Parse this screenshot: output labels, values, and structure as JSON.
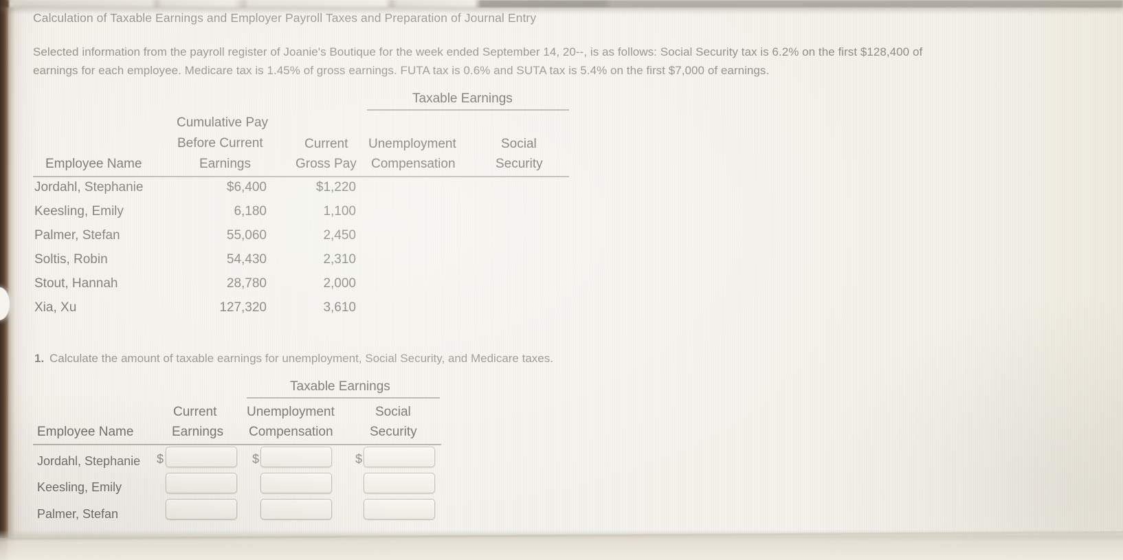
{
  "document": {
    "title": "Calculation of Taxable Earnings and Employer Payroll Taxes and Preparation of Journal Entry",
    "intro_line_1": "Selected information from the payroll register of Joanie's Boutique for the week ended September 14, 20--, is as follows: Social Security tax is 6.2% on the first $128,400 of",
    "intro_line_2": "earnings for each employee. Medicare tax is 1.45% of gross earnings. FUTA tax is 0.6% and SUTA tax is 5.4% on the first $7,000 of earnings."
  },
  "reference_table": {
    "group_header": "Taxable Earnings",
    "headers": {
      "employee_name": "Employee Name",
      "cumulative_line1": "Cumulative Pay",
      "cumulative_line2": "Before Current",
      "cumulative_line3": "Earnings",
      "current_line1": "Current",
      "current_line2": "Gross Pay",
      "unemployment_line1": "Unemployment",
      "unemployment_line2": "Compensation",
      "social_line1": "Social",
      "social_line2": "Security"
    },
    "rows": [
      {
        "name": "Jordahl, Stephanie",
        "cumulative": "$6,400",
        "gross": "$1,220"
      },
      {
        "name": "Keesling, Emily",
        "cumulative": "6,180",
        "gross": "1,100"
      },
      {
        "name": "Palmer, Stefan",
        "cumulative": "55,060",
        "gross": "2,450"
      },
      {
        "name": "Soltis, Robin",
        "cumulative": "54,430",
        "gross": "2,310"
      },
      {
        "name": "Stout, Hannah",
        "cumulative": "28,780",
        "gross": "2,000"
      },
      {
        "name": "Xia, Xu",
        "cumulative": "127,320",
        "gross": "3,610"
      }
    ]
  },
  "question": {
    "number": "1.",
    "text": "Calculate the amount of taxable earnings for unemployment, Social Security, and Medicare taxes."
  },
  "answer_table": {
    "group_header": "Taxable Earnings",
    "headers": {
      "employee_name": "Employee Name",
      "current_line1": "Current",
      "current_line2": "Earnings",
      "unemployment_line1": "Unemployment",
      "unemployment_line2": "Compensation",
      "social_line1": "Social",
      "social_line2": "Security"
    },
    "currency_symbol": "$",
    "rows": [
      {
        "name": "Jordahl, Stephanie",
        "show_currency": true,
        "current_earnings": "",
        "unemployment_compensation": "",
        "social_security": ""
      },
      {
        "name": "Keesling, Emily",
        "show_currency": false,
        "current_earnings": "",
        "unemployment_compensation": "",
        "social_security": ""
      },
      {
        "name": "Palmer, Stefan",
        "show_currency": false,
        "current_earnings": "",
        "unemployment_compensation": "",
        "social_security": ""
      }
    ]
  },
  "colors": {
    "page_background": "#f3f1ea",
    "text": "#8b8780",
    "table_text": "#6f6c66",
    "rule": "#a9a59c",
    "input_border": "#c3bfb5",
    "desk_edge": "#4a3628"
  }
}
